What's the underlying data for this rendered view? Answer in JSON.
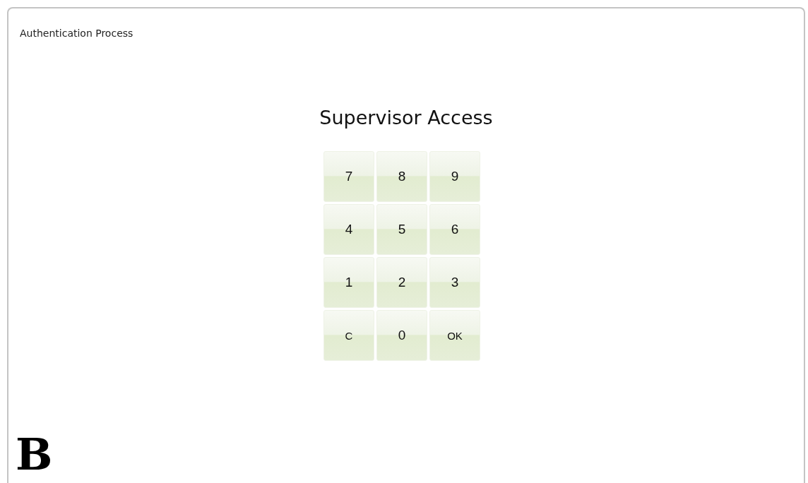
{
  "window": {
    "title": "Authentication Process"
  },
  "heading": "Supervisor Access",
  "keys": [
    {
      "label": "7"
    },
    {
      "label": "8"
    },
    {
      "label": "9"
    },
    {
      "label": "4"
    },
    {
      "label": "5"
    },
    {
      "label": "6"
    },
    {
      "label": "1"
    },
    {
      "label": "2"
    },
    {
      "label": "3"
    },
    {
      "label": "C",
      "kind": "small"
    },
    {
      "label": "0"
    },
    {
      "label": "OK",
      "kind": "small"
    }
  ],
  "logo": "B"
}
